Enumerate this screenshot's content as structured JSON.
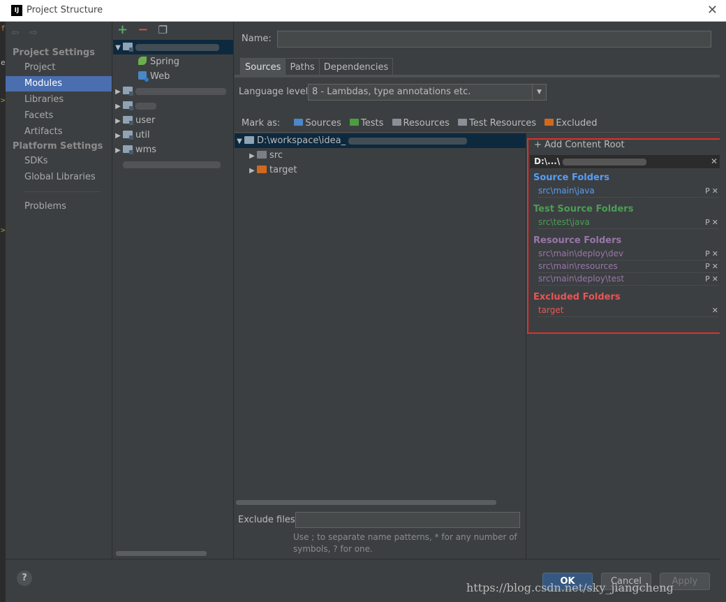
{
  "window": {
    "title": "Project Structure",
    "app_icon": "IJ"
  },
  "nav": {
    "back": "⇦",
    "forward": "⇨"
  },
  "sidebar": {
    "project_settings": "Project Settings",
    "platform_settings": "Platform Settings",
    "items": [
      "Project",
      "Modules",
      "Libraries",
      "Facets",
      "Artifacts"
    ],
    "platform_items": [
      "SDKs",
      "Global Libraries"
    ],
    "problems": "Problems"
  },
  "modules": {
    "toolbar": {
      "add": "+",
      "remove": "−",
      "copy": "❐"
    },
    "spring": "Spring",
    "web": "Web",
    "user": "user",
    "util": "util",
    "wms": "wms"
  },
  "main": {
    "name_label": "Name:",
    "tabs": [
      "Sources",
      "Paths",
      "Dependencies"
    ],
    "language_label": "Language level:",
    "language_value": "8 - Lambdas, type annotations etc.",
    "mark_as_label": "Mark as:",
    "mark_as": [
      {
        "label": "Sources",
        "color": "#4a88c7"
      },
      {
        "label": "Tests",
        "color": "#4b9e3f"
      },
      {
        "label": "Resources",
        "color": "#8a8f99"
      },
      {
        "label": "Test Resources",
        "color": "#8a8f99"
      },
      {
        "label": "Excluded",
        "color": "#d0691e"
      }
    ],
    "root_path": "D:\\workspace\\idea_",
    "src": "src",
    "target": "target",
    "exclude_label": "Exclude files:",
    "exclude_hint": "Use ; to separate name patterns, * for any number of symbols, ? for one."
  },
  "content_roots": {
    "add": "Add Content Root",
    "root": "D:\\...\\",
    "source_title": "Source Folders",
    "source_color": "#589df6",
    "sources": [
      "src\\main\\java"
    ],
    "test_title": "Test Source Folders",
    "test_color": "#4a9e55",
    "tests": [
      "src\\test\\java"
    ],
    "resource_title": "Resource Folders",
    "resource_color": "#9876aa",
    "resources": [
      "src\\main\\deploy\\dev",
      "src\\main\\resources",
      "src\\main\\deploy\\test"
    ],
    "excluded_title": "Excluded Folders",
    "excluded_color": "#e85555",
    "excluded": [
      "target"
    ]
  },
  "buttons": {
    "help": "?",
    "ok": "OK",
    "cancel": "Cancel",
    "apply": "Apply"
  },
  "watermark": "https://blog.csdn.net/sky_jiangcheng"
}
